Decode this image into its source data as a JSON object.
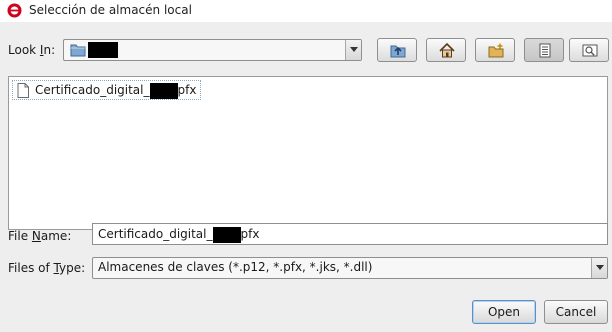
{
  "window": {
    "title": "Selección de almacén local",
    "icon": "app-logo-icon"
  },
  "look_in": {
    "label_before": "Look ",
    "label_mnemonic": "I",
    "label_after": "n:",
    "value_icon": "folder-icon",
    "value_redacted": true
  },
  "toolbar": {
    "buttons": [
      {
        "name": "up-one-level",
        "icon": "folder-up-icon"
      },
      {
        "name": "home",
        "icon": "home-icon"
      },
      {
        "name": "create-new-folder",
        "icon": "new-folder-icon"
      },
      {
        "name": "list-view",
        "icon": "list-view-icon",
        "active": true
      },
      {
        "name": "details-view",
        "icon": "details-view-icon"
      }
    ]
  },
  "files": [
    {
      "name_prefix": "Certificado_digital_",
      "name_suffix": "pfx",
      "icon": "file-icon"
    }
  ],
  "file_name": {
    "label_before": "File ",
    "label_mnemonic": "N",
    "label_after": "ame:",
    "value_prefix": "Certificado_digital_",
    "value_suffix": "pfx"
  },
  "files_of_type": {
    "label_before": "Files of ",
    "label_mnemonic": "T",
    "label_after": "ype:",
    "value": "Almacenes de claves (*.p12, *.pfx, *.jks, *.dll)"
  },
  "buttons": {
    "open": "Open",
    "cancel": "Cancel"
  },
  "colors": {
    "accent_red": "#d0021b",
    "folder_blue": "#7fa7cf",
    "focus_border": "#5e8fc4"
  }
}
